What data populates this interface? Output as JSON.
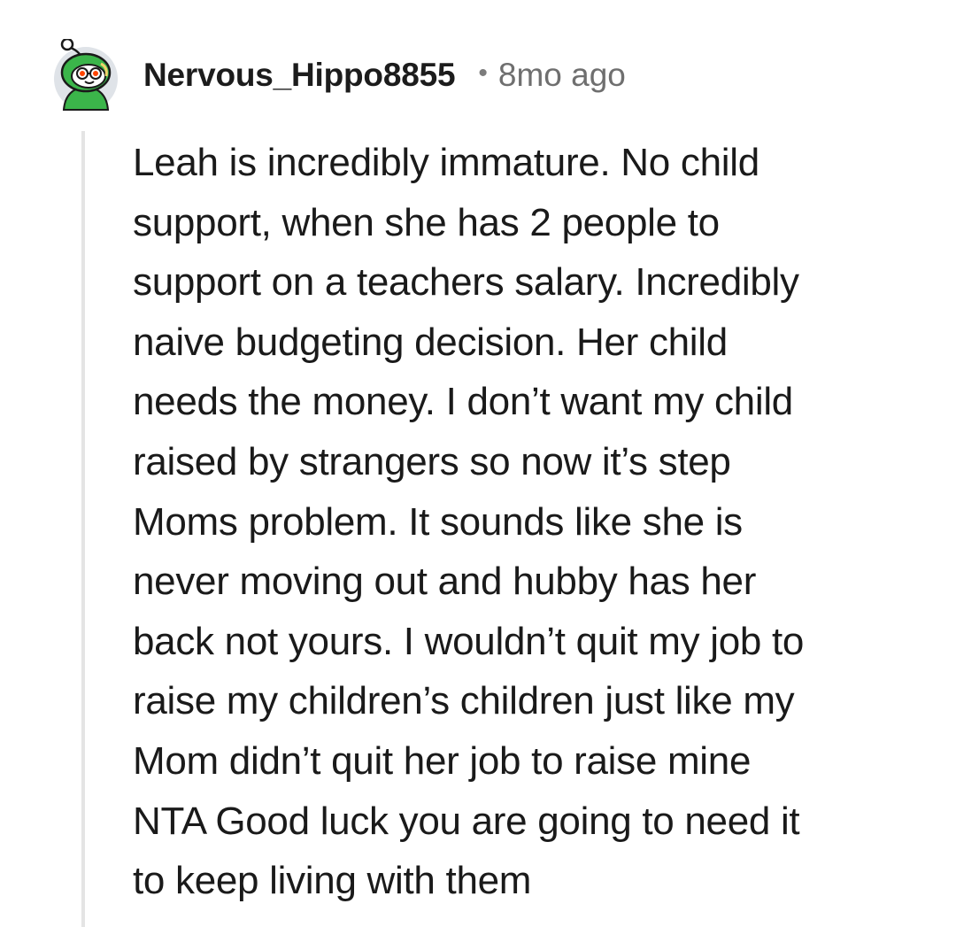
{
  "comment": {
    "author": "Nervous_Hippo8855",
    "separator": "•",
    "timestamp": "8mo ago",
    "avatar_icon": "snoo-avatar-icon",
    "body_lines": [
      "Leah is incredibly immature. No child",
      "support, when she has 2 people to",
      "support on a teachers salary. Incredibly",
      "naive budgeting decision. Her child",
      "needs the money. I don’t want my child",
      "raised by strangers so now it’s step",
      "Moms problem. It sounds like she is",
      "never moving out and hubby has her",
      "back not yours. I wouldn’t quit my job to",
      "raise my children’s children just like my",
      "Mom didn’t quit her job to raise mine",
      "NTA Good luck you are going to need it",
      "to keep living with them"
    ]
  },
  "colors": {
    "avatar_green": "#3bb54a",
    "avatar_bg": "#dfe3e8",
    "thread_line": "#e4e4e4",
    "timestamp": "#6f6f6f"
  }
}
